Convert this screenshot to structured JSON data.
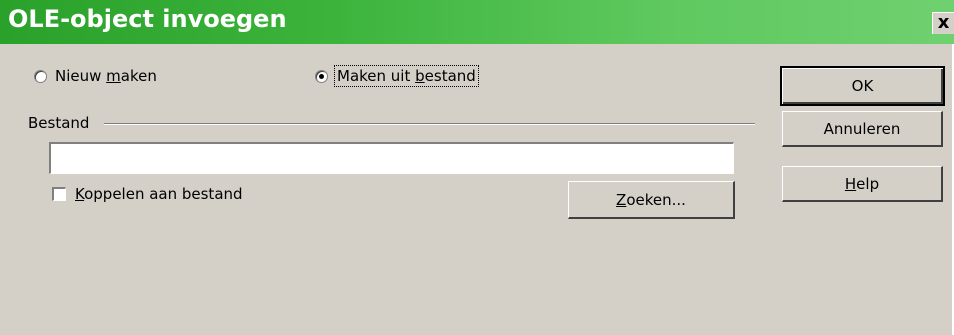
{
  "dialog": {
    "title": "OLE-object invoegen",
    "close_glyph": "x"
  },
  "options": {
    "new": {
      "pre": "Nieuw ",
      "key": "m",
      "post": "aken",
      "selected": false
    },
    "from_file": {
      "pre": "Maken uit ",
      "key": "b",
      "post": "estand",
      "selected": true
    }
  },
  "file_group": {
    "label": "Bestand",
    "input_value": "",
    "link_checkbox": {
      "key": "K",
      "post": "oppelen aan bestand",
      "checked": false
    },
    "browse_button": {
      "key": "Z",
      "post": "oeken..."
    }
  },
  "buttons": {
    "ok": "OK",
    "cancel": "Annuleren",
    "help": {
      "key": "H",
      "post": "elp"
    }
  }
}
